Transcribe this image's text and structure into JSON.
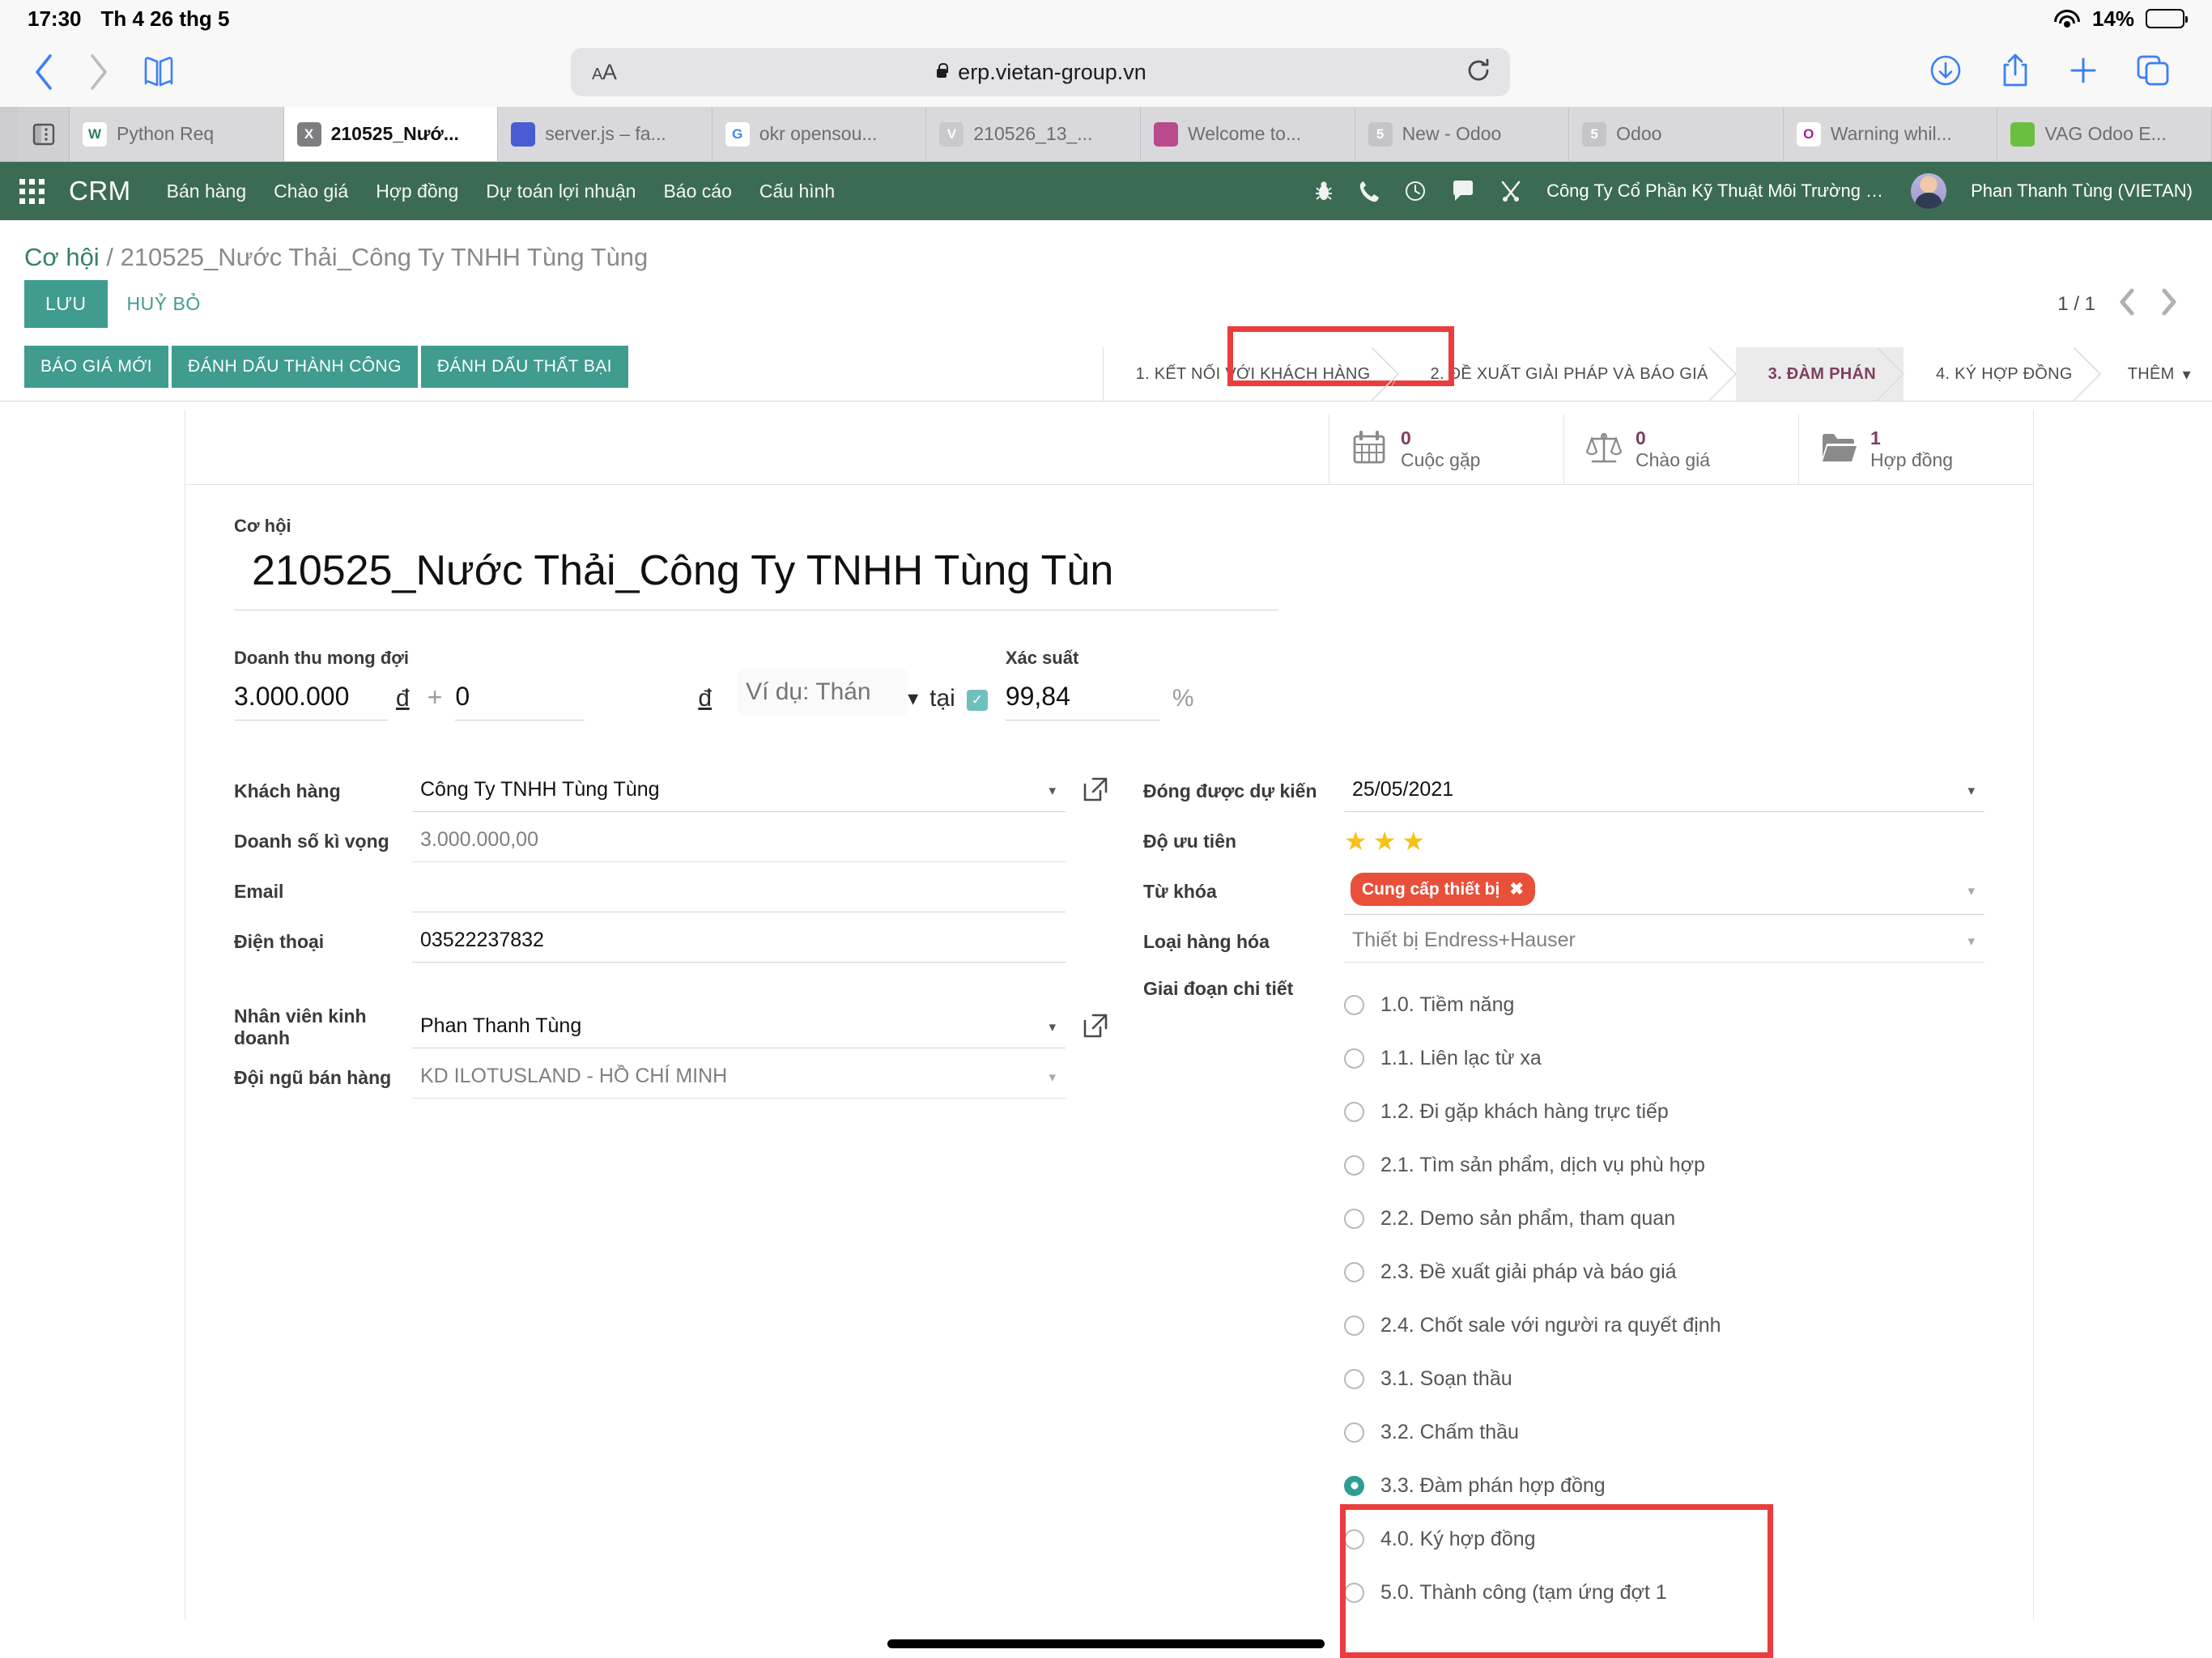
{
  "status_bar": {
    "time": "17:30",
    "date": "Th 4 26 thg 5",
    "wifi_icon": "wifi-icon",
    "battery_percent": "14%",
    "battery_level": 14
  },
  "browser": {
    "back_icon": "chevron-left-icon",
    "forward_icon": "chevron-right-icon",
    "bookmarks_icon": "book-icon",
    "aa_label": "A",
    "aa_label_small": "A",
    "url": "erp.vietan-group.vn",
    "lock_icon": "lock-icon",
    "reload_icon": "reload-icon",
    "downloads_icon": "download-icon",
    "share_icon": "share-icon",
    "new_tab_icon": "plus-icon",
    "tabs_overview_icon": "tabs-icon",
    "sidebar_icon": "sidebar-icon"
  },
  "tabs": [
    {
      "title": "Python Req",
      "favicon_text": "W",
      "favicon_color": "#ffffff",
      "favicon_fg": "#2e7d5b",
      "active": false
    },
    {
      "title": "210525_Nướ...",
      "favicon_text": "X",
      "favicon_color": "#7d7d82",
      "favicon_fg": "#ffffff",
      "active": true
    },
    {
      "title": "server.js – fa...",
      "favicon_text": "",
      "favicon_color": "#4a5bd4",
      "favicon_fg": "#ffffff",
      "active": false
    },
    {
      "title": "okr opensou...",
      "favicon_text": "G",
      "favicon_color": "#ffffff",
      "favicon_fg": "#4285f4",
      "active": false
    },
    {
      "title": "210526_13_...",
      "favicon_text": "V",
      "favicon_color": "#c9c9cd",
      "favicon_fg": "#ffffff",
      "active": false
    },
    {
      "title": "Welcome to...",
      "favicon_text": "",
      "favicon_color": "#b94a8c",
      "favicon_fg": "#ffffff",
      "active": false
    },
    {
      "title": "New - Odoo",
      "favicon_text": "5",
      "favicon_color": "#c5c5c9",
      "favicon_fg": "#ffffff",
      "active": false
    },
    {
      "title": "Odoo",
      "favicon_text": "5",
      "favicon_color": "#c5c5c9",
      "favicon_fg": "#ffffff",
      "active": false
    },
    {
      "title": "Warning whil...",
      "favicon_text": "O",
      "favicon_color": "#ffffff",
      "favicon_fg": "#a2248f",
      "active": false
    },
    {
      "title": "VAG Odoo E...",
      "favicon_text": "",
      "favicon_color": "#6abf3d",
      "favicon_fg": "#ffffff",
      "active": false
    }
  ],
  "odoo_nav": {
    "apps_icon": "apps-grid-icon",
    "brand": "CRM",
    "menu": [
      {
        "label": "Bán hàng"
      },
      {
        "label": "Chào giá"
      },
      {
        "label": "Hợp đồng"
      },
      {
        "label": "Dự toán lợi nhuận"
      },
      {
        "label": "Báo cáo"
      },
      {
        "label": "Cấu hình"
      }
    ],
    "icons": [
      "bug-icon",
      "phone-icon",
      "clock-icon",
      "chat-icon",
      "tools-icon"
    ],
    "company": "Công Ty Cổ Phần Kỹ Thuật Môi Trường Vi...",
    "user": "Phan Thanh Tùng (VIETAN)",
    "brand_color": "#3c6b53"
  },
  "breadcrumb": {
    "root": "Cơ hội",
    "separator": "/",
    "current": "210525_Nước Thải_Công Ty TNHH Tùng Tùng"
  },
  "actions": {
    "save_label": "LƯU",
    "discard_label": "HUỶ BỎ",
    "pager_text": "1 / 1",
    "pager_prev_icon": "chevron-left-icon",
    "pager_next_icon": "chevron-right-icon"
  },
  "stage_buttons": [
    {
      "label": "BÁO GIÁ MỚI"
    },
    {
      "label": "ĐÁNH DẤU THÀNH CÔNG"
    },
    {
      "label": "ĐÁNH DẤU THẤT BẠI"
    }
  ],
  "pipeline": {
    "stages": [
      {
        "label": "1. KẾT NỐI VỚI KHÁCH HÀNG",
        "active": false
      },
      {
        "label": "2. ĐỀ XUẤT GIẢI PHÁP VÀ BÁO GIÁ",
        "active": false
      },
      {
        "label": "3. ĐÀM PHÁN",
        "active": true
      },
      {
        "label": "4. KÝ HỢP ĐỒNG",
        "active": false
      }
    ],
    "more_label": "THÊM",
    "more_caret": "▾",
    "highlight_color": "#ea3d3d"
  },
  "stat_buttons": [
    {
      "value": "0",
      "label": "Cuộc gặp",
      "icon": "calendar-icon"
    },
    {
      "value": "0",
      "label": "Chào giá",
      "icon": "scales-icon"
    },
    {
      "value": "1",
      "label": "Hợp đồng",
      "icon": "folder-icon"
    }
  ],
  "form": {
    "opportunity_label": "Cơ hội",
    "opportunity_name": "210525_Nước Thải_Công Ty TNHH Tùng Tùn",
    "revenue": {
      "label": "Doanh thu mong đợi",
      "amount": "3.000.000",
      "currency": "đ",
      "plus": "+",
      "extra_amount": "0",
      "extra_currency": "đ",
      "date_placeholder": "Ví dụ: Thán",
      "date_caret": "▾",
      "at_label": "tại",
      "checkbox_checked": true,
      "probability_label": "Xác suất",
      "probability": "99,84",
      "percent_symbol": "%"
    },
    "left_fields": [
      {
        "label": "Khách hàng",
        "value": "Công Ty TNHH Tùng Tùng",
        "type": "select",
        "external_link": true,
        "readonly": false
      },
      {
        "label": "Doanh số kì vọng",
        "value": "3.000.000,00",
        "type": "text",
        "external_link": false,
        "readonly": true
      },
      {
        "label": "Email",
        "value": "",
        "type": "text",
        "external_link": false,
        "readonly": false
      },
      {
        "label": "Điện thoại",
        "value": "03522237832",
        "type": "text",
        "external_link": false,
        "readonly": false
      },
      {
        "label": "Nhân viên kinh doanh",
        "value": "Phan Thanh Tùng",
        "type": "select",
        "external_link": true,
        "readonly": false
      },
      {
        "label": "Đội ngũ bán hàng",
        "value": "KD ILOTUSLAND - HỒ CHÍ MINH",
        "type": "select",
        "external_link": false,
        "readonly": true
      }
    ],
    "right_fields": [
      {
        "label": "Đóng được dự kiến",
        "value": "25/05/2021",
        "type": "select",
        "readonly": false
      },
      {
        "label": "Độ ưu tiên",
        "value": "",
        "type": "stars",
        "stars": 3,
        "star_color": "#f7c117"
      },
      {
        "label": "Từ khóa",
        "value": "",
        "type": "tags",
        "tags": [
          {
            "text": "Cung cấp thiết bị",
            "remove_icon": "✖",
            "color": "#e8503a"
          }
        ]
      },
      {
        "label": "Loại hàng hóa",
        "value": "Thiết bị Endress+Hauser",
        "type": "select",
        "readonly": true
      }
    ],
    "detail_stage": {
      "label": "Giai đoạn chi tiết",
      "options": [
        {
          "label": "1.0. Tiềm năng",
          "checked": false
        },
        {
          "label": "1.1. Liên lạc từ xa",
          "checked": false
        },
        {
          "label": "1.2. Đi gặp khách hàng trực tiếp",
          "checked": false
        },
        {
          "label": "2.1. Tìm sản phẩm, dịch vụ phù hợp",
          "checked": false
        },
        {
          "label": "2.2. Demo sản phẩm, tham quan",
          "checked": false
        },
        {
          "label": "2.3. Đề xuất giải pháp và báo giá",
          "checked": false
        },
        {
          "label": "2.4. Chốt sale với người ra quyết định",
          "checked": false
        },
        {
          "label": "3.1. Soạn thầu",
          "checked": false
        },
        {
          "label": "3.2. Chấm thầu",
          "checked": false
        },
        {
          "label": "3.3. Đàm phán hợp đồng",
          "checked": true
        },
        {
          "label": "4.0. Ký hợp đồng",
          "checked": false
        },
        {
          "label": "5.0. Thành công (tạm ứng đợt 1",
          "checked": false
        }
      ]
    }
  },
  "colors": {
    "odoo_green": "#3c6b53",
    "teal_button": "#3f9c8f",
    "accent_purple": "#7d3f5f",
    "highlight_red": "#ea3d3d",
    "tag_red": "#e8503a"
  }
}
